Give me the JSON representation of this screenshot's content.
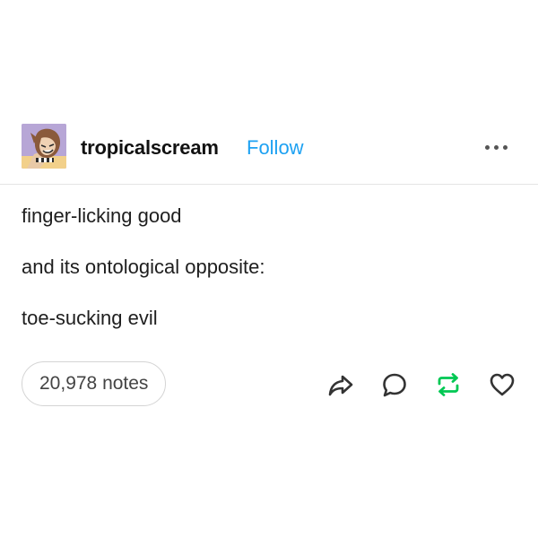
{
  "post": {
    "username": "tropicalscream",
    "follow_label": "Follow",
    "avatar_icon": "user-avatar-illustration",
    "more_icon": "more-options-icon",
    "lines": [
      "finger-licking good",
      "and its ontological opposite:",
      "toe-sucking evil"
    ],
    "notes_label": "20,978 notes",
    "actions": {
      "share_icon": "share-icon",
      "reply_icon": "reply-icon",
      "reblog_icon": "reblog-icon",
      "like_icon": "heart-icon"
    },
    "colors": {
      "follow": "#1da1f2",
      "reblog": "#00c853",
      "icon": "#333333"
    }
  }
}
